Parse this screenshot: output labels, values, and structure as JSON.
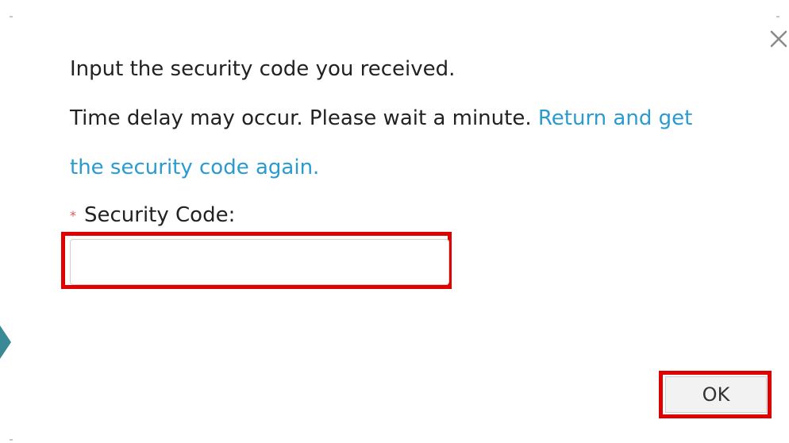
{
  "dialog": {
    "instruction": "Input the security code you received.",
    "delay_notice": "Time delay may occur. Please wait a minute.",
    "return_link_part1": "Return and get",
    "return_link_part2": "the security code again.",
    "required_marker": "*",
    "field_label": "Security Code:",
    "field_value": "",
    "field_placeholder": "",
    "ok_label": "OK",
    "close_glyph": "×"
  },
  "icons": {
    "close": "close-icon",
    "side": "chevron-right-icon"
  },
  "colors": {
    "link": "#2a9bd0",
    "required": "#e05555",
    "highlight": "#e00000",
    "side_chevron": "#3a8a96"
  }
}
